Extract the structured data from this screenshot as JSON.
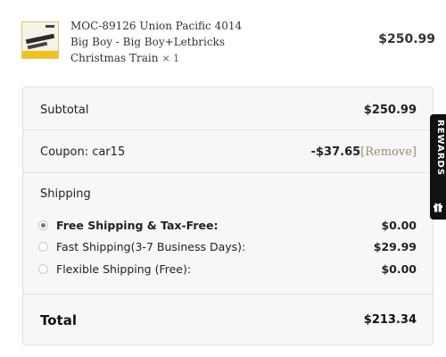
{
  "product": {
    "line1": "MOC-89126 Union Pacific 4014",
    "line2": "Big Boy - Big Boy+Letbricks",
    "line3": "Christmas Train",
    "qty": "× 1",
    "price": "$250.99",
    "thumbnail_icon": "train-thumbnail"
  },
  "summary": {
    "subtotal_label": "Subtotal",
    "subtotal_value": "$250.99",
    "coupon_label": "Coupon: car15",
    "coupon_value": "-$37.65",
    "coupon_remove": "[Remove]",
    "shipping_title": "Shipping",
    "shipping_options": [
      {
        "label": "Free Shipping & Tax-Free:",
        "price": "$0.00",
        "selected": true
      },
      {
        "label": "Fast Shipping(3-7 Business Days):",
        "price": "$29.99",
        "selected": false
      },
      {
        "label": "Flexible Shipping (Free):",
        "price": "$0.00",
        "selected": false
      }
    ],
    "total_label": "Total",
    "total_value": "$213.34"
  },
  "rewards_tab": {
    "label": "REWARDS",
    "icon": "gift-icon"
  },
  "colors": {
    "panel_bg": "#f7f7f7",
    "radio_selected": "#8a6d5a",
    "remove_link": "#9a8a70",
    "rewards_bg": "#111111"
  }
}
